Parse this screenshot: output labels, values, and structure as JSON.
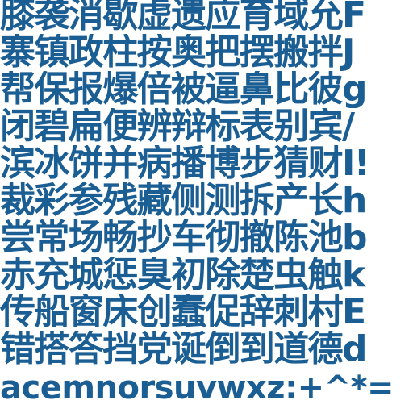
{
  "color": "#1b5e93",
  "lines": [
    "膝袭消歇虚遗应育域允F",
    "寨镇政柱按奥把摆搬拌J",
    "帮保报爆倍被逼鼻比彼g",
    "闭碧扁便辨辩标表别宾/",
    "滨冰饼并病播博步猜财I!",
    "裁彩参残藏侧测拆产长h",
    "尝常场畅抄车彻撤陈池b",
    "赤充城惩臭初除楚虫触k",
    "传船窗床创蠢促辞刺村E",
    "错搭答挡党诞倒到道德d",
    "acemnorsuvwxz:+^*="
  ]
}
